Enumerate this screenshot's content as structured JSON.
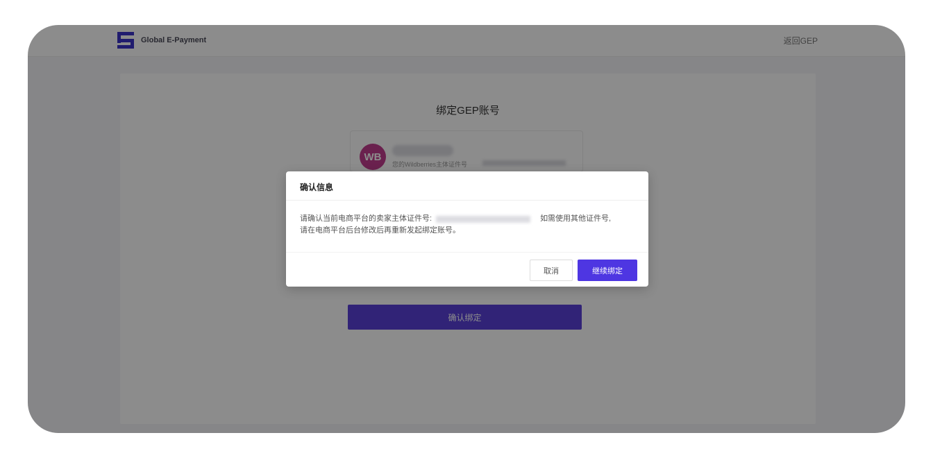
{
  "header": {
    "brand_name": "Global E-Payment",
    "back_link": "返回GEP"
  },
  "card": {
    "title": "绑定GEP账号",
    "account": {
      "avatar_initials": "WB",
      "subtitle": "您的Wildberries主体证件号"
    },
    "primary_button": "确认绑定"
  },
  "dialog": {
    "title": "确认信息",
    "body_line1_prefix": "请确认当前电商平台的卖家主体证件号:",
    "body_line1_suffix": "如需使用其他证件号,",
    "body_line2": "请在电商平台后台修改后再重新发起绑定账号。",
    "cancel_label": "取消",
    "confirm_label": "继续绑定"
  },
  "colors": {
    "accent": "#4e36e2",
    "avatar": "#c23c8e",
    "overlay": "rgba(0,0,0,0.45)"
  }
}
